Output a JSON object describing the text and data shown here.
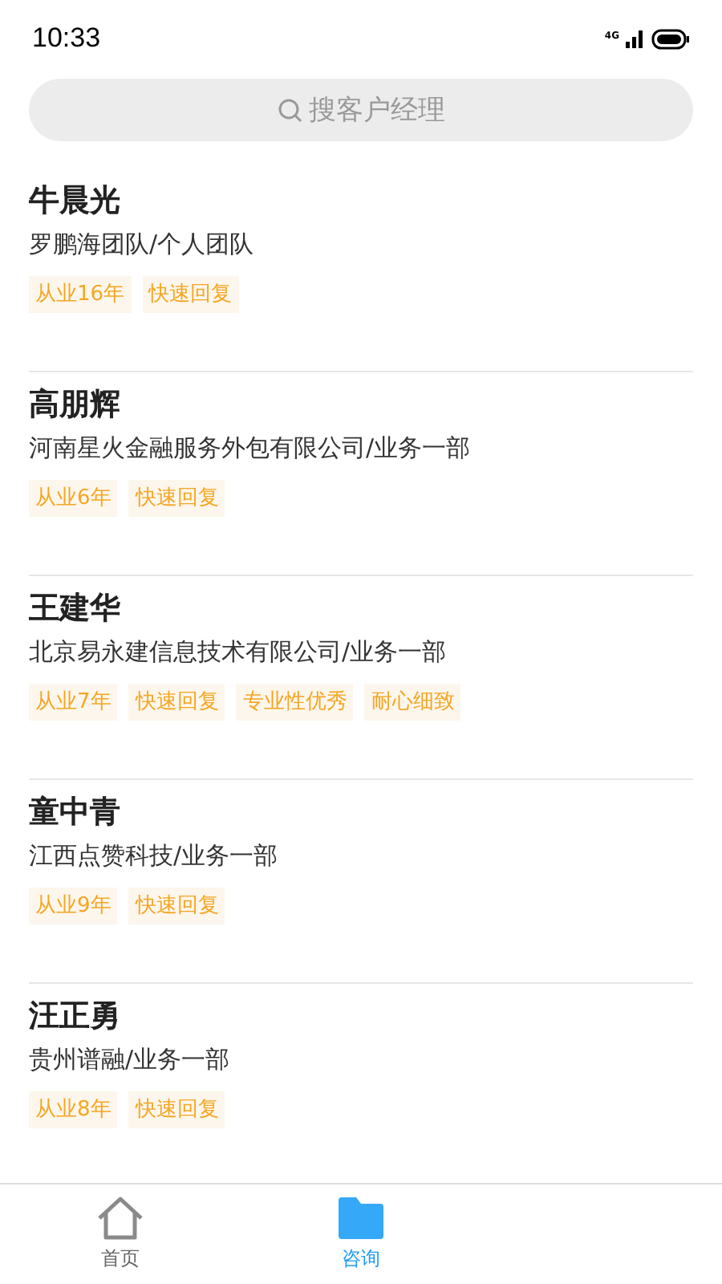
{
  "status_bar": {
    "time": "10:33",
    "network": "4G"
  },
  "search": {
    "placeholder": "搜客户经理"
  },
  "managers": [
    {
      "name": "牛晨光",
      "company": "罗鹏海团队/个人团队",
      "tags": [
        "从业16年",
        "快速回复"
      ]
    },
    {
      "name": "高朋辉",
      "company": "河南星火金融服务外包有限公司/业务一部",
      "tags": [
        "从业6年",
        "快速回复"
      ]
    },
    {
      "name": "王建华",
      "company": "北京易永建信息技术有限公司/业务一部",
      "tags": [
        "从业7年",
        "快速回复",
        "专业性优秀",
        "耐心细致"
      ]
    },
    {
      "name": "童中青",
      "company": "江西点赞科技/业务一部",
      "tags": [
        "从业9年",
        "快速回复"
      ]
    },
    {
      "name": "汪正勇",
      "company": "贵州谱融/业务一部",
      "tags": [
        "从业8年",
        "快速回复"
      ]
    }
  ],
  "tab_bar": [
    {
      "label": "首页",
      "selected": false
    },
    {
      "label": "咨询",
      "selected": true
    }
  ]
}
